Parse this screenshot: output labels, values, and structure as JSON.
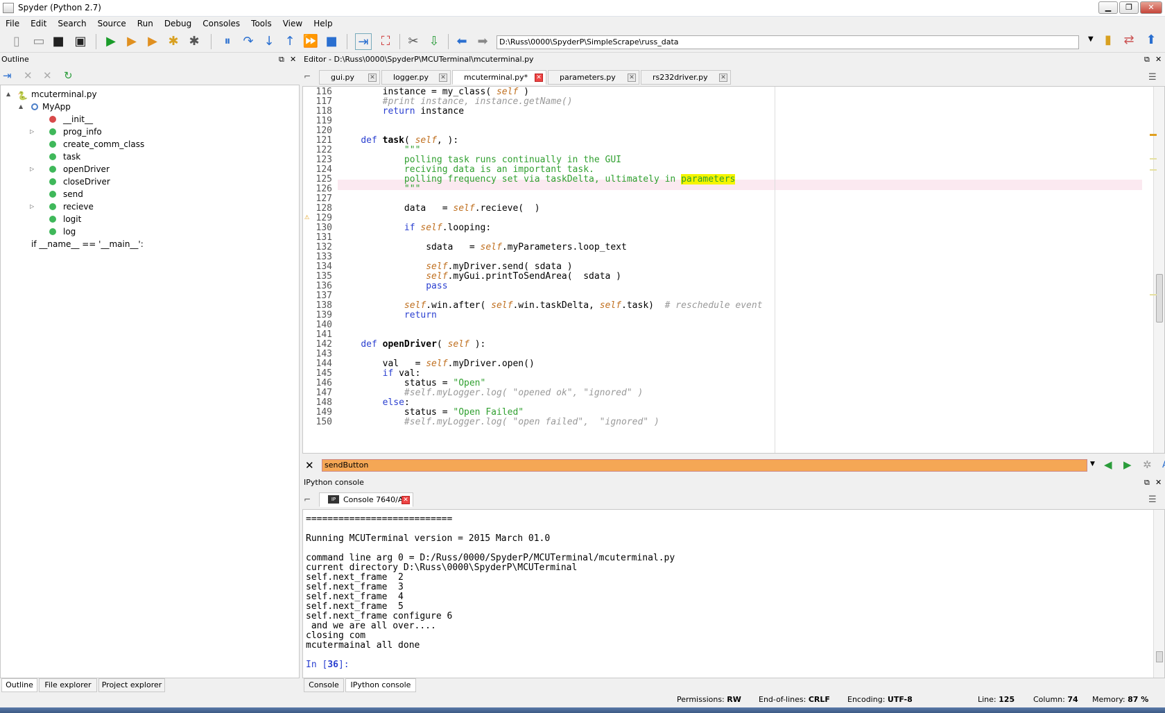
{
  "window": {
    "title": "Spyder (Python 2.7)"
  },
  "menu": [
    "File",
    "Edit",
    "Search",
    "Source",
    "Run",
    "Debug",
    "Consoles",
    "Tools",
    "View",
    "Help"
  ],
  "toolbar": {
    "path": "D:\\Russ\\0000\\SpyderP\\SimpleScrape\\russ_data"
  },
  "outline": {
    "title": "Outline",
    "tree": [
      {
        "label": "mcuterminal.py",
        "indent": 0,
        "kind": "file",
        "arrow": "▲"
      },
      {
        "label": "MyApp",
        "indent": 1,
        "kind": "class",
        "arrow": "▲"
      },
      {
        "label": "__init__",
        "indent": 2,
        "kind": "red",
        "arrow": ""
      },
      {
        "label": "prog_info",
        "indent": 2,
        "kind": "green",
        "arrow": "▷"
      },
      {
        "label": "create_comm_class",
        "indent": 2,
        "kind": "green",
        "arrow": ""
      },
      {
        "label": "task",
        "indent": 2,
        "kind": "green",
        "arrow": ""
      },
      {
        "label": "openDriver",
        "indent": 2,
        "kind": "green",
        "arrow": "▷"
      },
      {
        "label": "closeDriver",
        "indent": 2,
        "kind": "green",
        "arrow": ""
      },
      {
        "label": "send",
        "indent": 2,
        "kind": "green",
        "arrow": ""
      },
      {
        "label": "recieve",
        "indent": 2,
        "kind": "green",
        "arrow": "▷"
      },
      {
        "label": "logit",
        "indent": 2,
        "kind": "green",
        "arrow": ""
      },
      {
        "label": "log",
        "indent": 2,
        "kind": "green",
        "arrow": ""
      },
      {
        "label": "if __name__ == '__main__':",
        "indent": 1,
        "kind": "none",
        "arrow": ""
      }
    ],
    "bottom_tabs": [
      "Outline",
      "File explorer",
      "Project explorer"
    ]
  },
  "editor": {
    "title": "Editor - D:\\Russ\\0000\\SpyderP\\MCUTerminal\\mcuterminal.py",
    "tabs": [
      "gui.py",
      "logger.py",
      "mcuterminal.py*",
      "parameters.py",
      "rs232driver.py"
    ],
    "lines": [
      {
        "n": "116",
        "t": "        instance = my_class( self )"
      },
      {
        "n": "117",
        "t": "        #print instance, instance.getName()"
      },
      {
        "n": "118",
        "t": "        return instance"
      },
      {
        "n": "119",
        "t": ""
      },
      {
        "n": "120",
        "t": ""
      },
      {
        "n": "121",
        "t": "    def task( self, ):"
      },
      {
        "n": "122",
        "t": "            \"\"\""
      },
      {
        "n": "123",
        "t": "            polling task runs continually in the GUI"
      },
      {
        "n": "124",
        "t": "            reciving data is an important task."
      },
      {
        "n": "125",
        "t": "            polling frequency set via taskDelta, ultimately in parameters"
      },
      {
        "n": "126",
        "t": "            \"\"\""
      },
      {
        "n": "127",
        "t": ""
      },
      {
        "n": "128",
        "t": "            data   = self.recieve(  )"
      },
      {
        "n": "129",
        "t": ""
      },
      {
        "n": "130",
        "t": "            if self.looping:"
      },
      {
        "n": "131",
        "t": ""
      },
      {
        "n": "132",
        "t": "                sdata   = self.myParameters.loop_text"
      },
      {
        "n": "133",
        "t": ""
      },
      {
        "n": "134",
        "t": "                self.myDriver.send( sdata )"
      },
      {
        "n": "135",
        "t": "                self.myGui.printToSendArea(  sdata )"
      },
      {
        "n": "136",
        "t": "                pass"
      },
      {
        "n": "137",
        "t": ""
      },
      {
        "n": "138",
        "t": "            self.win.after( self.win.taskDelta, self.task)  # reschedule event"
      },
      {
        "n": "139",
        "t": "            return"
      },
      {
        "n": "140",
        "t": ""
      },
      {
        "n": "141",
        "t": ""
      },
      {
        "n": "142",
        "t": "    def openDriver( self ):"
      },
      {
        "n": "143",
        "t": ""
      },
      {
        "n": "144",
        "t": "        val   = self.myDriver.open()"
      },
      {
        "n": "145",
        "t": "        if val:"
      },
      {
        "n": "146",
        "t": "            status = \"Open\""
      },
      {
        "n": "147",
        "t": "            #self.myLogger.log( \"opened ok\", \"ignored\" )"
      },
      {
        "n": "148",
        "t": "        else:"
      },
      {
        "n": "149",
        "t": "            status = \"Open Failed\""
      },
      {
        "n": "150",
        "t": "            #self.myLogger.log( \"open failed\",  \"ignored\" )"
      }
    ]
  },
  "find": {
    "value": "sendButton"
  },
  "console": {
    "title": "IPython console",
    "tab": "Console 7640/A",
    "lines": [
      "===========================",
      "",
      "Running MCUTerminal version = 2015 March 01.0",
      "",
      "command line arg 0 = D:/Russ/0000/SpyderP/MCUTerminal/mcuterminal.py",
      "current directory D:\\Russ\\0000\\SpyderP\\MCUTerminal",
      "self.next_frame  2",
      "self.next_frame  3",
      "self.next_frame  4",
      "self.next_frame  5",
      "self.next_frame configure 6",
      " and we are all over....",
      "closing com",
      "mcutermainal all done",
      "",
      "In [36]:"
    ],
    "bottom_tabs": [
      "Console",
      "IPython console"
    ]
  },
  "status": {
    "permissions_label": "Permissions:",
    "permissions": "RW",
    "eol_label": "End-of-lines:",
    "eol": "CRLF",
    "encoding_label": "Encoding:",
    "encoding": "UTF-8",
    "line_label": "Line:",
    "line": "125",
    "column_label": "Column:",
    "column": "74",
    "memory_label": "Memory:",
    "memory": "87 %"
  }
}
